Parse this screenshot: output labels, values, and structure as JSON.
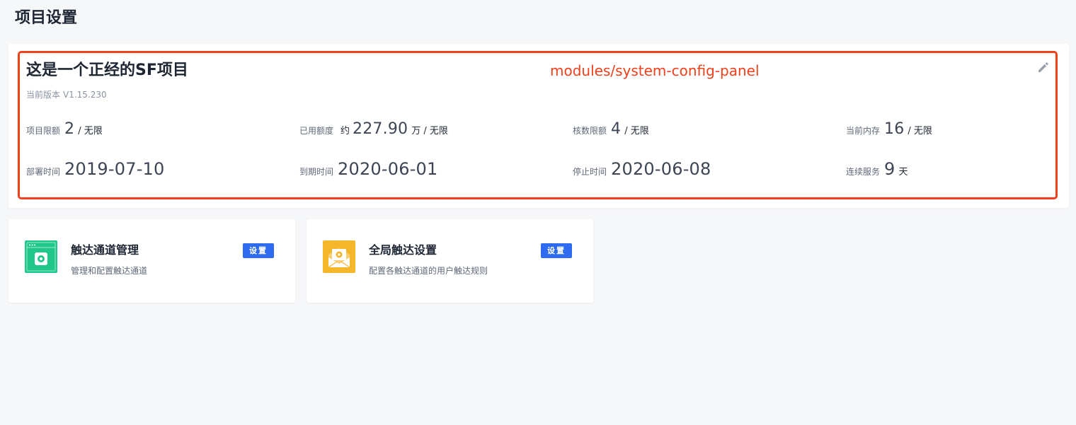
{
  "page": {
    "title": "项目设置"
  },
  "project": {
    "name": "这是一个正经的SF项目",
    "module_path": "modules/system-config-panel",
    "version_label": "当前版本",
    "version": "V1.15.230",
    "edit_icon": "pencil-icon",
    "stats_row1": [
      {
        "label": "项目限额",
        "prefix": "",
        "value": "2",
        "unit": "/ 无限"
      },
      {
        "label": "已用额度",
        "prefix": "约",
        "value": "227.90",
        "unit": "万 / 无限"
      },
      {
        "label": "核数限额",
        "prefix": "",
        "value": "4",
        "unit": "/ 无限"
      },
      {
        "label": "当前内存",
        "prefix": "",
        "value": "16",
        "unit": "/ 无限"
      }
    ],
    "stats_row2": [
      {
        "label": "部署时间",
        "value": "2019-07-10",
        "unit": ""
      },
      {
        "label": "到期时间",
        "value": "2020-06-01",
        "unit": ""
      },
      {
        "label": "停止时间",
        "value": "2020-06-08",
        "unit": ""
      },
      {
        "label": "连续服务",
        "value": "9",
        "unit": "天"
      }
    ]
  },
  "features": [
    {
      "title": "触达通道管理",
      "description": "管理和配置触达通道",
      "button_label": "设置",
      "icon": "browser-gear-icon",
      "icon_color": "#1fc88a"
    },
    {
      "title": "全局触达设置",
      "description": "配置各触达通道的用户触达规则",
      "button_label": "设置",
      "icon": "envelope-gear-icon",
      "icon_color": "#f5b62c"
    }
  ],
  "colors": {
    "accent": "#2f6bf0",
    "highlight": "#f0401c",
    "background": "#f6f7f9"
  }
}
